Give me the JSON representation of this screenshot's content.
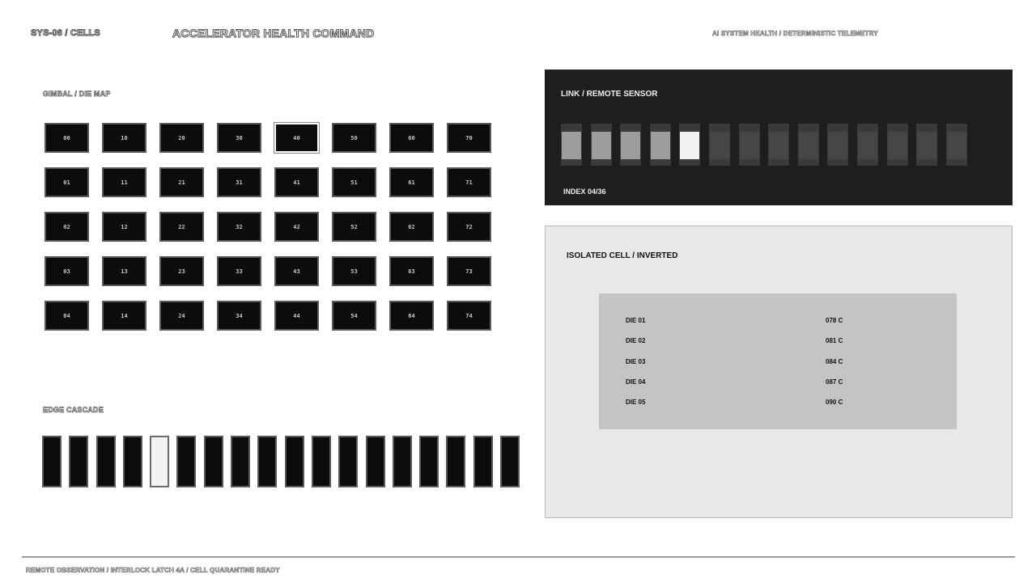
{
  "header": {
    "sys_label": "SYS-06 / CELLS",
    "title": "ACCELERATOR HEALTH COMMAND",
    "subtitle": "AI SYSTEM HEALTH / DETERMINISTIC TELEMETRY"
  },
  "grid": {
    "label": "GIMBAL / DIE MAP",
    "selected": "40",
    "rows": [
      [
        "00",
        "10",
        "20",
        "30",
        "40",
        "50",
        "60",
        "70"
      ],
      [
        "01",
        "11",
        "21",
        "31",
        "41",
        "51",
        "61",
        "71"
      ],
      [
        "02",
        "12",
        "22",
        "32",
        "42",
        "52",
        "62",
        "72"
      ],
      [
        "03",
        "13",
        "23",
        "33",
        "43",
        "53",
        "63",
        "73"
      ],
      [
        "04",
        "14",
        "24",
        "34",
        "44",
        "54",
        "64",
        "74"
      ]
    ]
  },
  "cascade": {
    "label": "EDGE CASCADE",
    "count": 18,
    "active_index": 4
  },
  "remote": {
    "title": "LINK / REMOTE SENSOR",
    "index_label": "INDEX 04/36",
    "bar_count": 14,
    "active_index": 4,
    "lit_count": 5
  },
  "isolated": {
    "title": "ISOLATED CELL / INVERTED",
    "readings": [
      {
        "die": "DIE 01",
        "temp": "078 C"
      },
      {
        "die": "DIE 02",
        "temp": "081 C"
      },
      {
        "die": "DIE 03",
        "temp": "084 C"
      },
      {
        "die": "DIE 04",
        "temp": "087 C"
      },
      {
        "die": "DIE 05",
        "temp": "090 C"
      }
    ]
  },
  "footer": {
    "text": "REMOTE OBSERVATION / INTERLOCK LATCH 4A / CELL QUARANTINE READY"
  },
  "colors": {
    "panel_dark": "#1e1e1e",
    "panel_light": "#e8e8e8",
    "die_fill": "#0c0c0c",
    "accent_white": "#f2f2f2"
  }
}
